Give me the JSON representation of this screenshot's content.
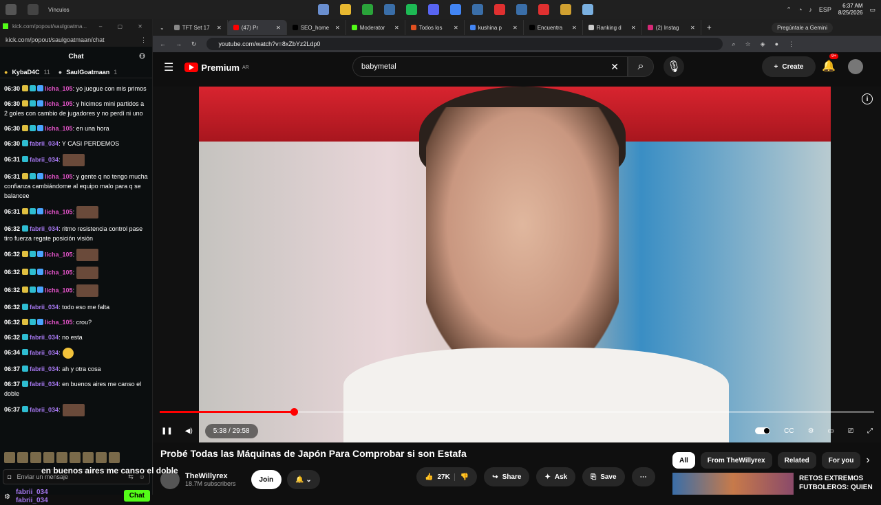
{
  "taskbar": {
    "tab_label": "Vínculos",
    "lang": "ESP",
    "time": "6:37 AM",
    "date": "8/25/2026",
    "app_colors": [
      "#6a8fd0",
      "#e8b830",
      "#2aa43a",
      "#3a6ea8",
      "#1db954",
      "#5865f2",
      "#4285f4",
      "#3a6ea8",
      "#e03030",
      "#3a6ea8",
      "#e03030",
      "#d0a030",
      "#7ab0e0"
    ]
  },
  "chat": {
    "window_title": "kick.com/popout/saulgoatma...",
    "url": "kick.com/popout/saulgoatmaan/chat",
    "header": "Chat",
    "pinned": [
      {
        "name": "KybaD4C",
        "count": "11"
      },
      {
        "name": "SaulGoatmaan",
        "count": "1"
      }
    ],
    "messages": [
      {
        "time": "06:30",
        "user": "licha_105",
        "text": ": yo juegue con mis primos",
        "kind": "licha"
      },
      {
        "time": "06:30",
        "user": "licha_105",
        "text": ": y hicimos mini partidos a 2 goles con cambio de jugadores y no perdí ni uno",
        "kind": "licha"
      },
      {
        "time": "06:30",
        "user": "licha_105",
        "text": ": en una hora",
        "kind": "licha"
      },
      {
        "time": "06:30",
        "user": "fabrii_034",
        "text": ": Y CASI PERDEMOS",
        "kind": "fabrii"
      },
      {
        "time": "06:31",
        "user": "fabrii_034",
        "text": ":",
        "kind": "fabrii",
        "img": true
      },
      {
        "time": "06:31",
        "user": "licha_105",
        "text": ": y gente q no tengo mucha confianza cambiándome al equipo malo para q se balancee",
        "kind": "licha"
      },
      {
        "time": "06:31",
        "user": "licha_105",
        "text": ":",
        "kind": "licha",
        "img": true
      },
      {
        "time": "06:32",
        "user": "fabrii_034",
        "text": ": ritmo resistencia control pase tiro fuerza regate posición visión",
        "kind": "fabrii"
      },
      {
        "time": "06:32",
        "user": "licha_105",
        "text": ":",
        "kind": "licha",
        "img": true
      },
      {
        "time": "06:32",
        "user": "licha_105",
        "text": ":",
        "kind": "licha",
        "img": true
      },
      {
        "time": "06:32",
        "user": "licha_105",
        "text": ":",
        "kind": "licha",
        "img": true
      },
      {
        "time": "06:32",
        "user": "fabrii_034",
        "text": ": todo eso me falta",
        "kind": "fabrii"
      },
      {
        "time": "06:32",
        "user": "licha_105",
        "text": ": crou?",
        "kind": "licha"
      },
      {
        "time": "06:32",
        "user": "fabrii_034",
        "text": ": no esta",
        "kind": "fabrii"
      },
      {
        "time": "06:34",
        "user": "fabrii_034",
        "text": ":",
        "kind": "fabrii",
        "emo": true
      },
      {
        "time": "06:37",
        "user": "fabrii_034",
        "text": ": ah y otra cosa",
        "kind": "fabrii"
      },
      {
        "time": "06:37",
        "user": "fabrii_034",
        "text": ": en buenos aires me canso el doble",
        "kind": "fabrii"
      },
      {
        "time": "06:37",
        "user": "fabrii_034",
        "text": ":",
        "kind": "fabrii",
        "img": true
      }
    ],
    "input_placeholder": "Enviar un mensaje",
    "bottom_user1": "fabrii_034",
    "bottom_user2": "fabrii_034",
    "chat_button": "Chat",
    "overlay_text": "en buenos aires me canso el doble"
  },
  "browser": {
    "tabs": [
      {
        "label": "TFT Set 17",
        "color": "#888"
      },
      {
        "label": "(47) Pr",
        "color": "#f00",
        "active": true
      },
      {
        "label": "SEO_home",
        "color": "#000"
      },
      {
        "label": "Moderator",
        "color": "#53fc18"
      },
      {
        "label": "Todos los",
        "color": "#e05020"
      },
      {
        "label": "kushina p",
        "color": "#4285f4"
      },
      {
        "label": "Encuentra",
        "color": "#000"
      },
      {
        "label": "Ranking d",
        "color": "#ccc"
      },
      {
        "label": "(2) Instag",
        "color": "#d62976"
      }
    ],
    "gemini": "Pregúntale a Gemini",
    "url": "youtube.com/watch?v=8xZbYz2Ldp0"
  },
  "youtube": {
    "logo": "Premium",
    "region": "AR",
    "search_value": "babymetal",
    "create": "Create",
    "notifications": "9+",
    "time": "5:38 / 29:58",
    "progress": 0.188,
    "title": "Probé Todas las Máquinas de Japón Para Comprobar si son Estafa",
    "channel": "TheWillyrex",
    "subscribers": "18.7M subscribers",
    "join": "Join",
    "likes": "27K",
    "share": "Share",
    "ask": "Ask",
    "save": "Save",
    "chips": [
      "All",
      "From TheWillyrex",
      "Related",
      "For you"
    ],
    "rec_title": "RETOS EXTREMOS FUTBOLEROS: QUIEN"
  }
}
